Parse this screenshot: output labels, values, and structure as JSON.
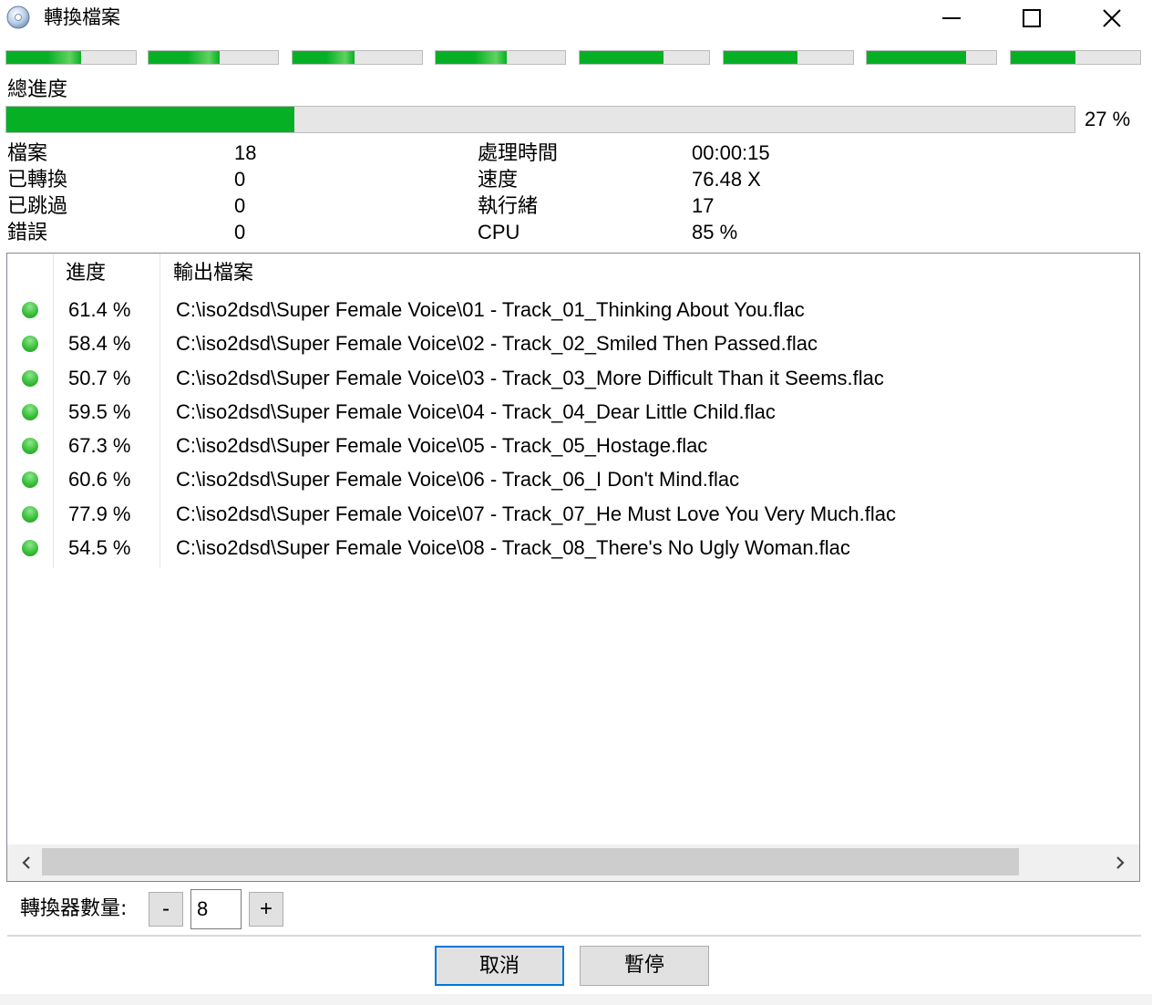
{
  "window": {
    "title": "轉換檔案",
    "app_icon": "disc-icon"
  },
  "mini_progress": [
    0.58,
    0.55,
    0.48,
    0.55,
    0.65,
    0.57,
    0.77,
    0.5
  ],
  "colors": {
    "progress_green": "#06b025",
    "mini_light_green": "#5fd35f",
    "accent_blue": "#0078d7"
  },
  "overall": {
    "label": "總進度",
    "percent_text": "27 %",
    "fraction": 0.27
  },
  "stats_left": [
    {
      "label": "檔案",
      "value": "18"
    },
    {
      "label": "已轉換",
      "value": "0"
    },
    {
      "label": "已跳過",
      "value": "0"
    },
    {
      "label": "錯誤",
      "value": "0"
    }
  ],
  "stats_right": [
    {
      "label": "處理時間",
      "value": "00:00:15"
    },
    {
      "label": "速度",
      "value": "76.48 X"
    },
    {
      "label": "執行緒",
      "value": "17"
    },
    {
      "label": "CPU",
      "value": "85 %"
    }
  ],
  "list": {
    "columns": [
      "進度",
      "輸出檔案"
    ],
    "rows": [
      {
        "progress": "61.4 %",
        "path": "C:\\iso2dsd\\Super Female Voice\\01 - Track_01_Thinking About You.flac"
      },
      {
        "progress": "58.4 %",
        "path": "C:\\iso2dsd\\Super Female Voice\\02 - Track_02_Smiled Then Passed.flac"
      },
      {
        "progress": "50.7 %",
        "path": "C:\\iso2dsd\\Super Female Voice\\03 - Track_03_More Difficult Than it Seems.flac"
      },
      {
        "progress": "59.5 %",
        "path": "C:\\iso2dsd\\Super Female Voice\\04 - Track_04_Dear Little Child.flac"
      },
      {
        "progress": "67.3 %",
        "path": "C:\\iso2dsd\\Super Female Voice\\05 - Track_05_Hostage.flac"
      },
      {
        "progress": "60.6 %",
        "path": "C:\\iso2dsd\\Super Female Voice\\06 - Track_06_I Don't Mind.flac"
      },
      {
        "progress": "77.9 %",
        "path": "C:\\iso2dsd\\Super Female Voice\\07 - Track_07_He Must Love You Very Much.flac"
      },
      {
        "progress": "54.5 %",
        "path": "C:\\iso2dsd\\Super Female Voice\\08 - Track_08_There's No Ugly Woman.flac"
      }
    ]
  },
  "converter": {
    "label": "轉換器數量:",
    "minus": "-",
    "plus": "+",
    "count": "8"
  },
  "buttons": {
    "cancel": "取消",
    "pause": "暫停"
  }
}
